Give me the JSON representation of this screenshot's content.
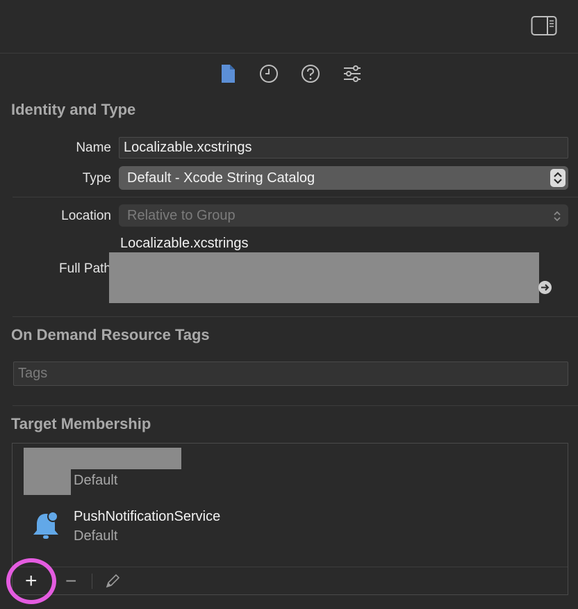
{
  "toolbar": {
    "tabs": [
      {
        "name": "file-inspector",
        "icon": "document-icon",
        "active": true
      },
      {
        "name": "history-inspector",
        "icon": "clock-icon",
        "active": false
      },
      {
        "name": "quick-help",
        "icon": "question-icon",
        "active": false
      },
      {
        "name": "attributes",
        "icon": "sliders-icon",
        "active": false
      }
    ]
  },
  "identity": {
    "title": "Identity and Type",
    "name_label": "Name",
    "name_value": "Localizable.xcstrings",
    "type_label": "Type",
    "type_value": "Default - Xcode String Catalog",
    "location_label": "Location",
    "location_value": "Relative to Group",
    "location_filename": "Localizable.xcstrings",
    "full_path_label": "Full Path"
  },
  "on_demand": {
    "title": "On Demand Resource Tags",
    "tags_placeholder": "Tags"
  },
  "target_membership": {
    "title": "Target Membership",
    "targets": [
      {
        "name": "",
        "config": "Default",
        "redacted": true
      },
      {
        "name": "PushNotificationService",
        "config": "Default",
        "icon": "bell-icon"
      }
    ],
    "add_label": "+",
    "remove_label": "−"
  },
  "colors": {
    "background": "#2a2a2a",
    "accent_icon": "#5c8fd6",
    "highlight_ring": "#e45ce0",
    "bell": "#62a8e8"
  }
}
